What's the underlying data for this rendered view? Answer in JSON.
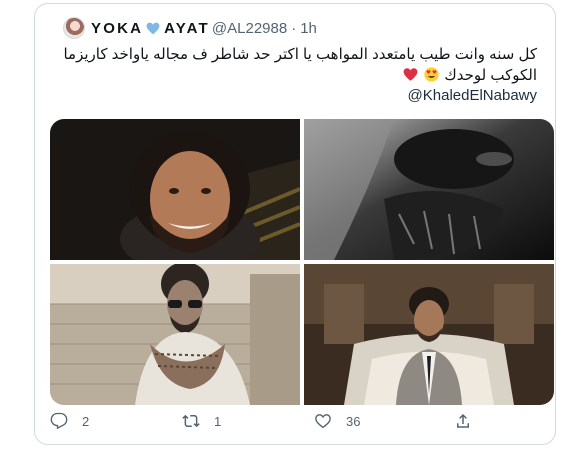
{
  "tweet": {
    "author_name_left": "YOKA",
    "author_name_right": "AYAT",
    "handle": "@AL22988",
    "separator": "·",
    "time": "1h",
    "text_line1": "كل سنه وانت طيب يامتعدد المواهب يا اكتر حد شاطر ف مجاله ياواخد كاريزما",
    "text_line2": "الكوكب لوحدك",
    "mention": "@KhaledElNabawy",
    "heart_color": "#7fb8e6"
  },
  "media": {
    "photos": [
      {
        "icon": "photo-portrait-smiling"
      },
      {
        "icon": "photo-bw-closeup"
      },
      {
        "icon": "photo-sepia-scarf"
      },
      {
        "icon": "photo-suit-chair"
      }
    ]
  },
  "actions": {
    "reply_count": "2",
    "retweet_count": "1",
    "like_count": "36"
  },
  "colors": {
    "text_secondary": "#536471",
    "border": "#cfd9de"
  }
}
